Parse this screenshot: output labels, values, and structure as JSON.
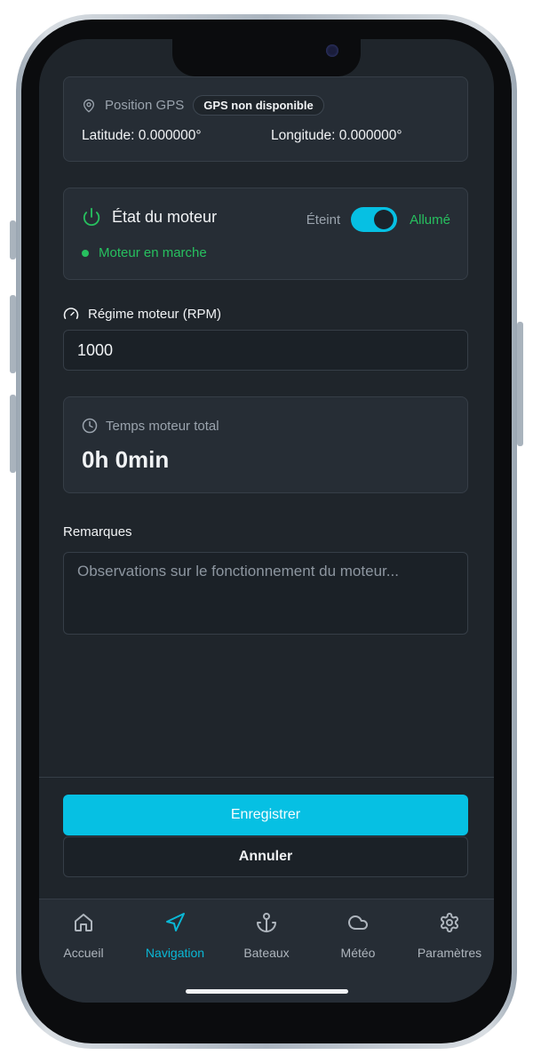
{
  "gps": {
    "label": "Position GPS",
    "badge": "GPS non disponible",
    "latitude": "Latitude: 0.000000°",
    "longitude": "Longitude: 0.000000°"
  },
  "engine": {
    "title": "État du moteur",
    "off_label": "Éteint",
    "on_label": "Allumé",
    "toggle_on": true,
    "status": "Moteur en marche"
  },
  "rpm": {
    "label": "Régime moteur (RPM)",
    "value": "1000"
  },
  "engine_hours": {
    "label": "Temps moteur total",
    "value": "0h 0min"
  },
  "remarks": {
    "label": "Remarques",
    "placeholder": "Observations sur le fonctionnement du moteur..."
  },
  "actions": {
    "save": "Enregistrer",
    "cancel": "Annuler"
  },
  "tabs": [
    {
      "label": "Accueil",
      "icon": "home-icon",
      "active": false
    },
    {
      "label": "Navigation",
      "icon": "navigation-icon",
      "active": true
    },
    {
      "label": "Bateaux",
      "icon": "anchor-icon",
      "active": false
    },
    {
      "label": "Météo",
      "icon": "cloud-icon",
      "active": false
    },
    {
      "label": "Paramètres",
      "icon": "gear-icon",
      "active": false
    }
  ],
  "colors": {
    "accent": "#06c0e3",
    "success": "#27c05f",
    "background": "#1f252b",
    "card": "#262d35"
  }
}
